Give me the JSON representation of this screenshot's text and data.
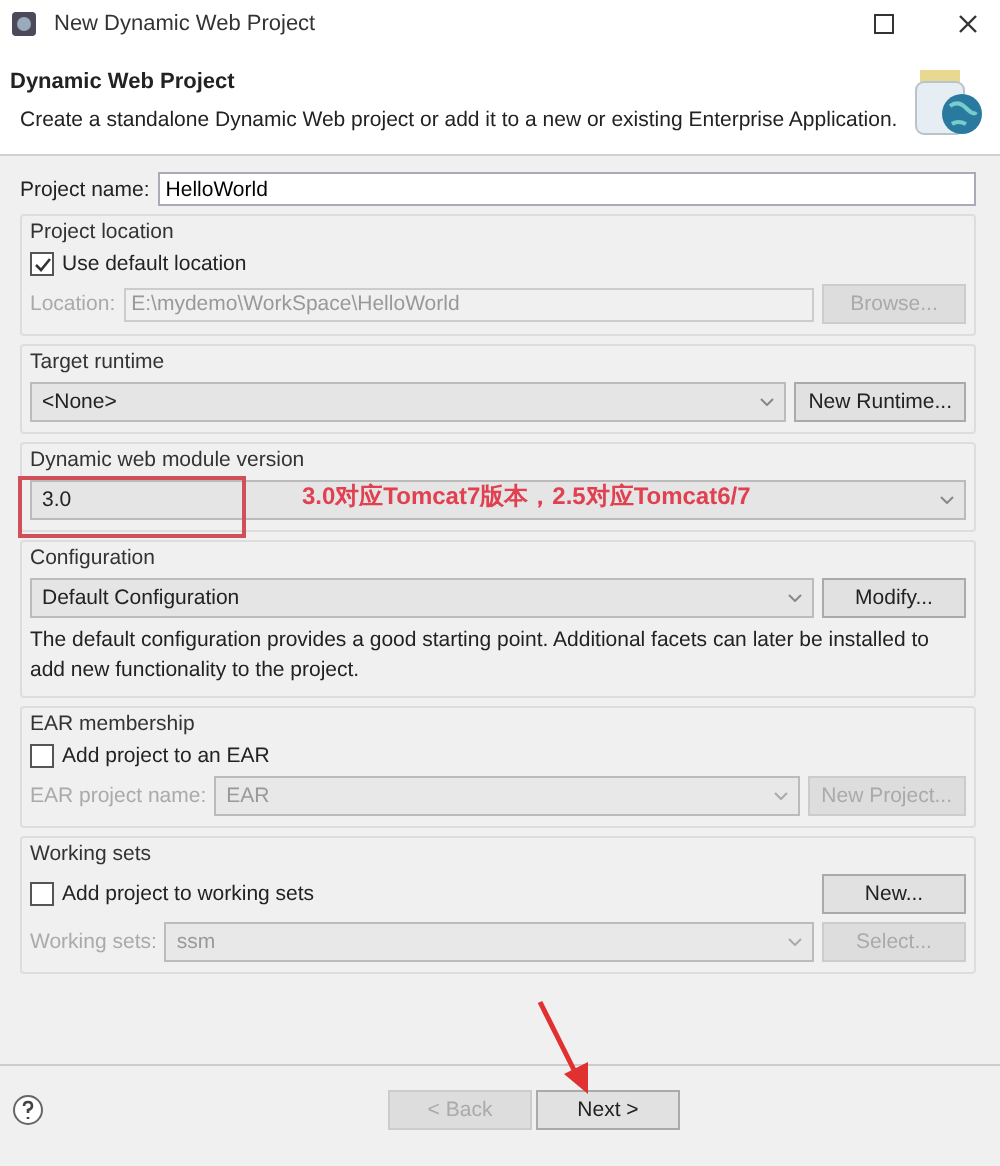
{
  "window": {
    "title": "New Dynamic Web Project"
  },
  "header": {
    "title": "Dynamic Web Project",
    "description": "Create a standalone Dynamic Web project or add it to a new or existing Enterprise Application."
  },
  "project_name": {
    "label": "Project name:",
    "value": "HelloWorld"
  },
  "project_location": {
    "title": "Project location",
    "use_default": {
      "label": "Use default location",
      "checked": true
    },
    "location": {
      "label": "Location:",
      "value": "E:\\mydemo\\WorkSpace\\HelloWorld",
      "disabled": true
    },
    "button": {
      "label": "Browse...",
      "disabled": true
    }
  },
  "target_runtime": {
    "title": "Target runtime",
    "value": "<None>",
    "button": {
      "label": "New Runtime...",
      "disabled": false
    }
  },
  "module_version": {
    "title": "Dynamic web module version",
    "value": "3.0",
    "annotation": "3.0对应Tomcat7版本，2.5对应Tomcat6/7"
  },
  "configuration": {
    "title": "Configuration",
    "value": "Default Configuration",
    "button": {
      "label": "Modify...",
      "disabled": false
    },
    "description": "The default configuration provides a good starting point. Additional facets can later be installed to add new functionality to the project."
  },
  "ear_membership": {
    "title": "EAR membership",
    "add": {
      "label": "Add project to an EAR",
      "checked": false
    },
    "field": {
      "label": "EAR project name:",
      "value": "EAR",
      "disabled": true
    },
    "button": {
      "label": "New Project...",
      "disabled": true
    }
  },
  "working_sets": {
    "title": "Working sets",
    "add": {
      "label": "Add project to working sets",
      "checked": false
    },
    "new_button": {
      "label": "New...",
      "disabled": false
    },
    "field": {
      "label": "Working sets:",
      "value": "ssm",
      "disabled": true
    },
    "button": {
      "label": "Select...",
      "disabled": true
    }
  },
  "buttons": [
    {
      "label": "< Back",
      "disabled": true
    },
    {
      "label": "Next >",
      "disabled": false
    }
  ]
}
